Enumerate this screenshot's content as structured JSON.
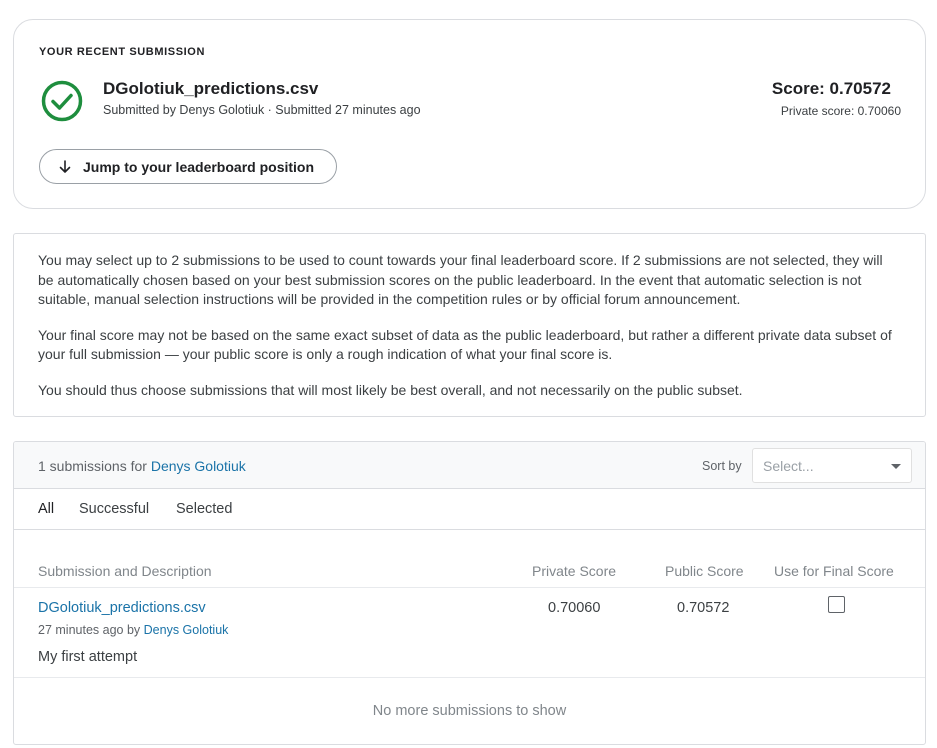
{
  "recent": {
    "heading": "YOUR RECENT SUBMISSION",
    "file_name": "DGolotiuk_predictions.csv",
    "submitted_meta": "Submitted by Denys Golotiuk · Submitted 27 minutes ago",
    "score": "Score: 0.70572",
    "private_score": "Private score: 0.70060",
    "jump_label": "Jump to your leaderboard position",
    "status_color": "#1e8e3e"
  },
  "info": {
    "p1": "You may select up to 2 submissions to be used to count towards your final leaderboard score. If 2 submissions are not selected, they will be automatically chosen based on your best submission scores on the public leaderboard. In the event that automatic selection is not suitable, manual selection instructions will be provided in the competition rules or by official forum announcement.",
    "p2": "Your final score may not be based on the same exact subset of data as the public leaderboard, but rather a different private data subset of your full submission — your public score is only a rough indication of what your final score is.",
    "p3": "You should thus choose submissions that will most likely be best overall, and not necessarily on the public subset."
  },
  "submissions": {
    "count_text": "1 submissions for",
    "user": "Denys Golotiuk",
    "sort_label": "Sort by",
    "sort_placeholder": "Select...",
    "tabs": [
      {
        "label": "All",
        "active": true
      },
      {
        "label": "Successful",
        "active": false
      },
      {
        "label": "Selected",
        "active": false
      }
    ],
    "columns": {
      "desc": "Submission and Description",
      "private": "Private Score",
      "public": "Public Score",
      "final": "Use for Final Score"
    },
    "rows": [
      {
        "file": "DGolotiuk_predictions.csv",
        "time": "27 minutes ago by",
        "user": "Denys Golotiuk",
        "description": "My first attempt",
        "private_score": "0.70060",
        "public_score": "0.70572",
        "use_for_final": false
      }
    ],
    "footer": "No more submissions to show"
  },
  "colors": {
    "link": "#1a73a8",
    "success": "#1e8e3e",
    "border": "#dadce0"
  }
}
